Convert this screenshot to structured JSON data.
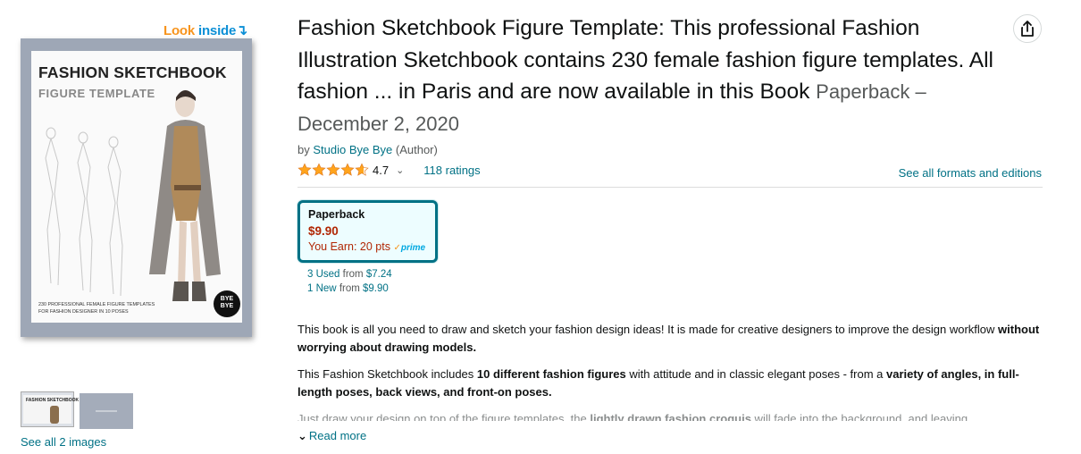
{
  "look_inside": {
    "word1": "Look",
    "word2": "inside",
    "arrow": "↴"
  },
  "cover": {
    "title": "FASHION SKETCHBOOK",
    "subtitle": "FIGURE TEMPLATE",
    "line1": "230 PROFESSIONAL FEMALE FIGURE TEMPLATES",
    "line2": "FOR FASHION DESIGNER IN 10 POSES",
    "badge_line1": "BYE",
    "badge_line2": "BYE"
  },
  "thumbnails": {
    "thumb1_title": "FASHION SKETCHBOOK",
    "see_all": "See all 2 images"
  },
  "product": {
    "title": "Fashion Sketchbook Figure Template: This professional Fashion Illustration Sketchbook contains 230 female fashion figure templates. All fashion ... in Paris and are now available in this Book",
    "format_date": "Paperback – December 2, 2020",
    "by": "by",
    "author": "Studio Bye Bye",
    "author_role": "(Author)",
    "rating_value": "4.7",
    "rating_stars": 4.7,
    "rating_chevron": "⌄",
    "ratings_count": "118 ratings",
    "see_all_formats": "See all formats and editions"
  },
  "format_option": {
    "name": "Paperback",
    "price": "$9.90",
    "earn": "You Earn: 20 pts",
    "prime_check": "✓",
    "prime_label": "prime"
  },
  "offers": {
    "used_link": "3 Used",
    "used_from": "from",
    "used_price": "$7.24",
    "new_link": "1 New",
    "new_from": "from",
    "new_price": "$9.90"
  },
  "description": {
    "p1_a": "This book is all you need to draw and sketch your fashion design ideas! It is made for creative designers to improve the design workflow ",
    "p1_b": "without worrying about drawing models.",
    "p2_a": "This Fashion Sketchbook includes ",
    "p2_b": "10 different fashion figures",
    "p2_c": " with attitude and in classic elegant poses - from a ",
    "p2_d": "variety of angles, in full-length poses, back views, and front-on poses.",
    "p3_a": "Just draw your design on top of the figure templates, the ",
    "p3_b": "lightly drawn fashion croquis",
    "p3_c": " will fade into the background, and leaving"
  },
  "read_more": {
    "chevron": "⌄",
    "label": "Read more"
  },
  "colors": {
    "link": "#007185",
    "price": "#b12704",
    "accent_border": "#007185",
    "star": "#ffa41c"
  }
}
